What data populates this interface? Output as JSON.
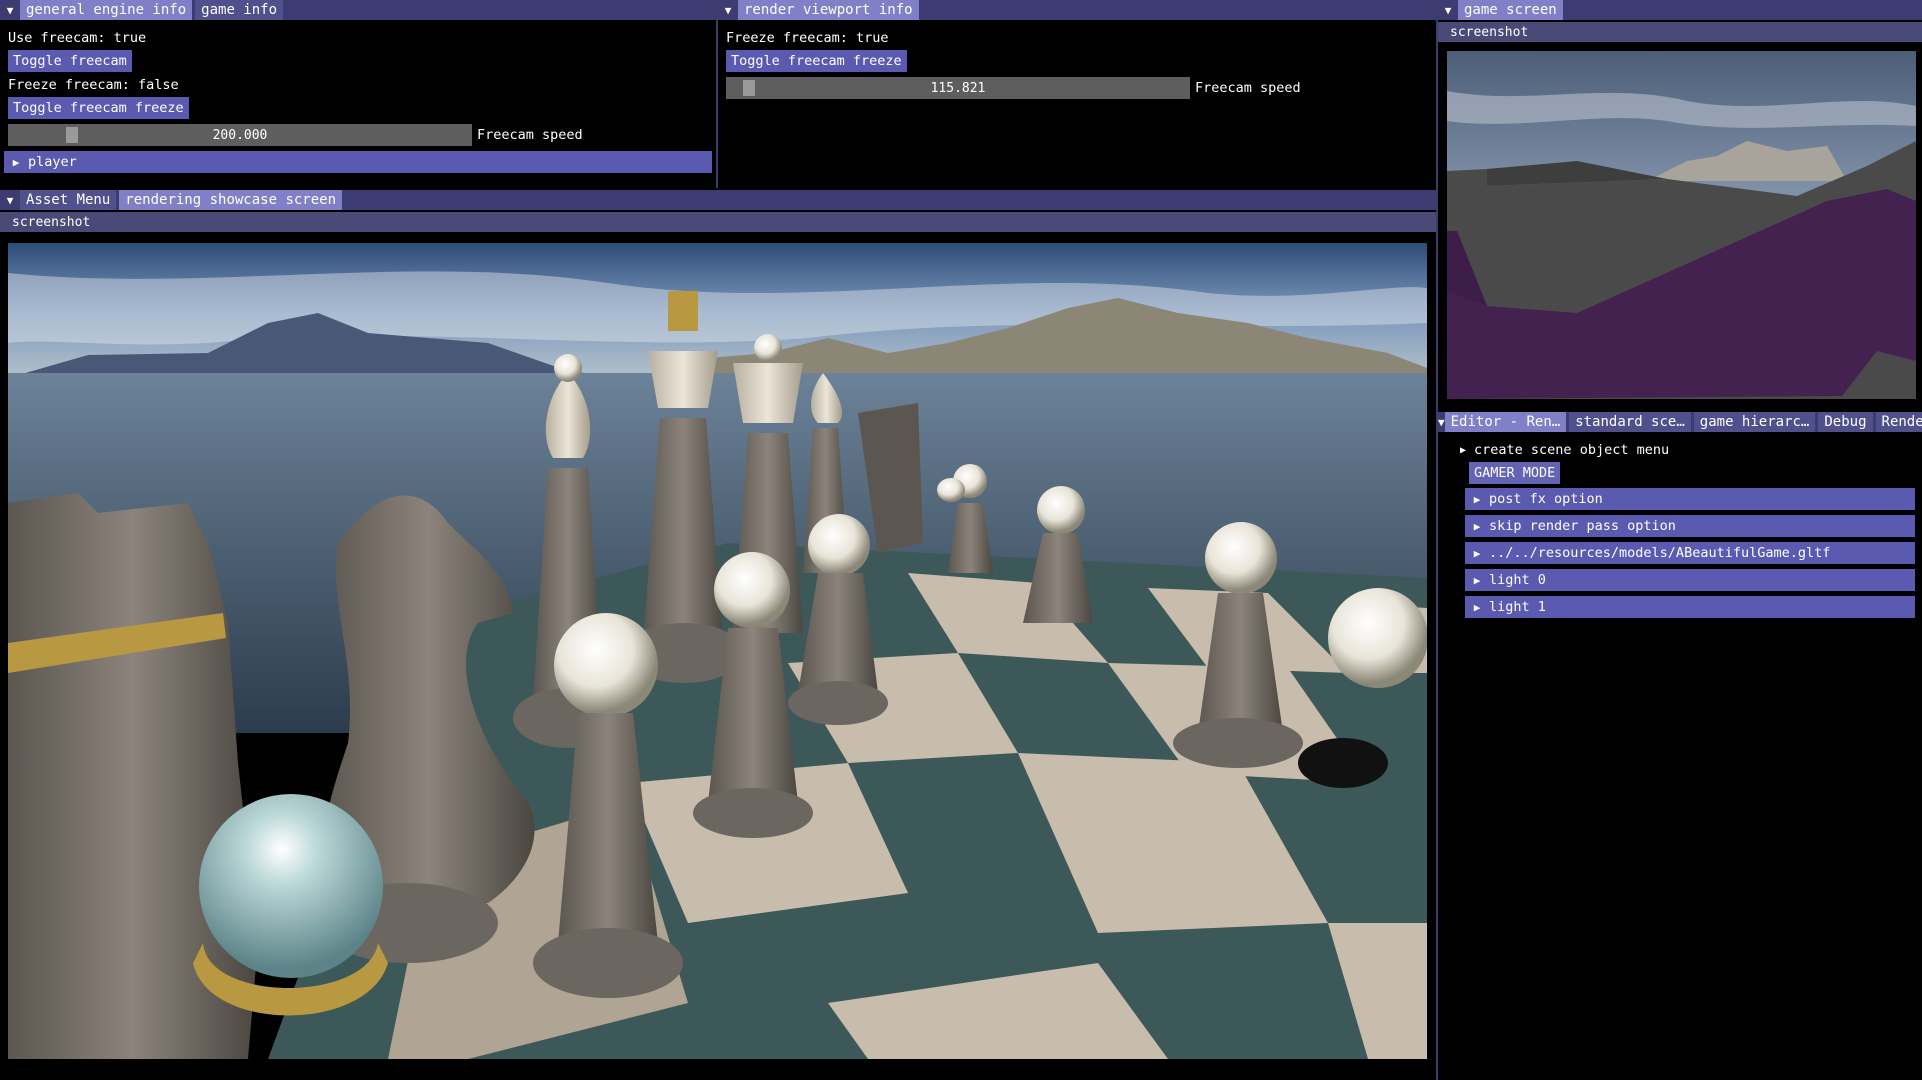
{
  "general_panel": {
    "tabs": [
      "general engine info",
      "game info"
    ],
    "use_freecam_text": "Use freecam: true",
    "toggle_freecam_label": "Toggle freecam",
    "freeze_freecam_text": "Freeze freecam: false",
    "toggle_freeze_label": "Toggle freecam freeze",
    "speed_value": "200.000",
    "speed_fraction": 0.12,
    "speed_label": "Freecam speed",
    "player_node": "player"
  },
  "render_panel": {
    "tabs": [
      "render viewport info"
    ],
    "freeze_text": "Freeze freecam: true",
    "toggle_freeze_label": "Toggle freecam freeze",
    "speed_value": "115.821",
    "speed_fraction": 0.03,
    "speed_label": "Freecam speed"
  },
  "game_panel": {
    "tabs": [
      "game screen"
    ],
    "sub_label": "screenshot"
  },
  "asset_panel": {
    "tabs": [
      "Asset Menu",
      "rendering showcase screen"
    ],
    "sub_label": "screenshot"
  },
  "editor_panel": {
    "tabs": [
      "Editor - Ren…",
      "standard sce…",
      "game hierarc…",
      "Debug",
      "Renderer"
    ],
    "create_menu": "create scene object menu",
    "gamer_mode_label": "GAMER MODE",
    "tree_items": [
      "post fx option",
      "skip render pass option",
      "../../resources/models/ABeautifulGame.gltf",
      "light 0",
      "light 1"
    ]
  },
  "icons": {
    "collapse": "triangle-down-icon",
    "expand": "triangle-right-icon"
  },
  "colors": {
    "tab_active": "#8080c8",
    "tab_bar": "#3c3c72",
    "button": "#5a5ab0",
    "background": "#000000"
  }
}
